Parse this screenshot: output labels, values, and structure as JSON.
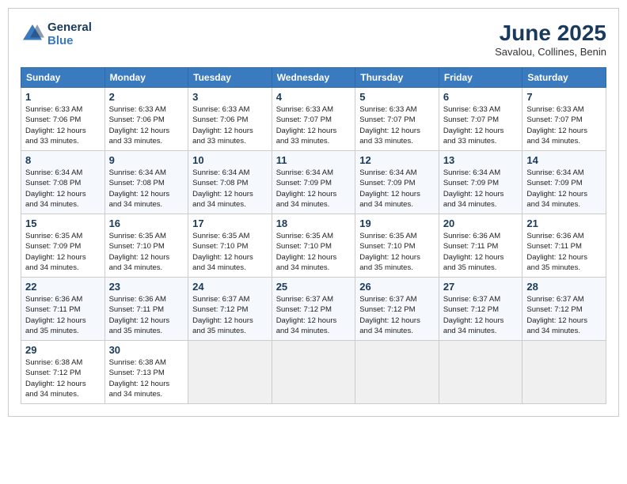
{
  "header": {
    "logo_line1": "General",
    "logo_line2": "Blue",
    "month": "June 2025",
    "location": "Savalou, Collines, Benin"
  },
  "weekdays": [
    "Sunday",
    "Monday",
    "Tuesday",
    "Wednesday",
    "Thursday",
    "Friday",
    "Saturday"
  ],
  "weeks": [
    [
      {
        "day": "1",
        "sunrise": "6:33 AM",
        "sunset": "7:06 PM",
        "daylight": "12 hours and 33 minutes."
      },
      {
        "day": "2",
        "sunrise": "6:33 AM",
        "sunset": "7:06 PM",
        "daylight": "12 hours and 33 minutes."
      },
      {
        "day": "3",
        "sunrise": "6:33 AM",
        "sunset": "7:06 PM",
        "daylight": "12 hours and 33 minutes."
      },
      {
        "day": "4",
        "sunrise": "6:33 AM",
        "sunset": "7:07 PM",
        "daylight": "12 hours and 33 minutes."
      },
      {
        "day": "5",
        "sunrise": "6:33 AM",
        "sunset": "7:07 PM",
        "daylight": "12 hours and 33 minutes."
      },
      {
        "day": "6",
        "sunrise": "6:33 AM",
        "sunset": "7:07 PM",
        "daylight": "12 hours and 33 minutes."
      },
      {
        "day": "7",
        "sunrise": "6:33 AM",
        "sunset": "7:07 PM",
        "daylight": "12 hours and 34 minutes."
      }
    ],
    [
      {
        "day": "8",
        "sunrise": "6:34 AM",
        "sunset": "7:08 PM",
        "daylight": "12 hours and 34 minutes."
      },
      {
        "day": "9",
        "sunrise": "6:34 AM",
        "sunset": "7:08 PM",
        "daylight": "12 hours and 34 minutes."
      },
      {
        "day": "10",
        "sunrise": "6:34 AM",
        "sunset": "7:08 PM",
        "daylight": "12 hours and 34 minutes."
      },
      {
        "day": "11",
        "sunrise": "6:34 AM",
        "sunset": "7:09 PM",
        "daylight": "12 hours and 34 minutes."
      },
      {
        "day": "12",
        "sunrise": "6:34 AM",
        "sunset": "7:09 PM",
        "daylight": "12 hours and 34 minutes."
      },
      {
        "day": "13",
        "sunrise": "6:34 AM",
        "sunset": "7:09 PM",
        "daylight": "12 hours and 34 minutes."
      },
      {
        "day": "14",
        "sunrise": "6:34 AM",
        "sunset": "7:09 PM",
        "daylight": "12 hours and 34 minutes."
      }
    ],
    [
      {
        "day": "15",
        "sunrise": "6:35 AM",
        "sunset": "7:09 PM",
        "daylight": "12 hours and 34 minutes."
      },
      {
        "day": "16",
        "sunrise": "6:35 AM",
        "sunset": "7:10 PM",
        "daylight": "12 hours and 34 minutes."
      },
      {
        "day": "17",
        "sunrise": "6:35 AM",
        "sunset": "7:10 PM",
        "daylight": "12 hours and 34 minutes."
      },
      {
        "day": "18",
        "sunrise": "6:35 AM",
        "sunset": "7:10 PM",
        "daylight": "12 hours and 34 minutes."
      },
      {
        "day": "19",
        "sunrise": "6:35 AM",
        "sunset": "7:10 PM",
        "daylight": "12 hours and 35 minutes."
      },
      {
        "day": "20",
        "sunrise": "6:36 AM",
        "sunset": "7:11 PM",
        "daylight": "12 hours and 35 minutes."
      },
      {
        "day": "21",
        "sunrise": "6:36 AM",
        "sunset": "7:11 PM",
        "daylight": "12 hours and 35 minutes."
      }
    ],
    [
      {
        "day": "22",
        "sunrise": "6:36 AM",
        "sunset": "7:11 PM",
        "daylight": "12 hours and 35 minutes."
      },
      {
        "day": "23",
        "sunrise": "6:36 AM",
        "sunset": "7:11 PM",
        "daylight": "12 hours and 35 minutes."
      },
      {
        "day": "24",
        "sunrise": "6:37 AM",
        "sunset": "7:12 PM",
        "daylight": "12 hours and 35 minutes."
      },
      {
        "day": "25",
        "sunrise": "6:37 AM",
        "sunset": "7:12 PM",
        "daylight": "12 hours and 34 minutes."
      },
      {
        "day": "26",
        "sunrise": "6:37 AM",
        "sunset": "7:12 PM",
        "daylight": "12 hours and 34 minutes."
      },
      {
        "day": "27",
        "sunrise": "6:37 AM",
        "sunset": "7:12 PM",
        "daylight": "12 hours and 34 minutes."
      },
      {
        "day": "28",
        "sunrise": "6:37 AM",
        "sunset": "7:12 PM",
        "daylight": "12 hours and 34 minutes."
      }
    ],
    [
      {
        "day": "29",
        "sunrise": "6:38 AM",
        "sunset": "7:12 PM",
        "daylight": "12 hours and 34 minutes."
      },
      {
        "day": "30",
        "sunrise": "6:38 AM",
        "sunset": "7:13 PM",
        "daylight": "12 hours and 34 minutes."
      },
      {
        "day": "",
        "sunrise": "",
        "sunset": "",
        "daylight": ""
      },
      {
        "day": "",
        "sunrise": "",
        "sunset": "",
        "daylight": ""
      },
      {
        "day": "",
        "sunrise": "",
        "sunset": "",
        "daylight": ""
      },
      {
        "day": "",
        "sunrise": "",
        "sunset": "",
        "daylight": ""
      },
      {
        "day": "",
        "sunrise": "",
        "sunset": "",
        "daylight": ""
      }
    ]
  ]
}
